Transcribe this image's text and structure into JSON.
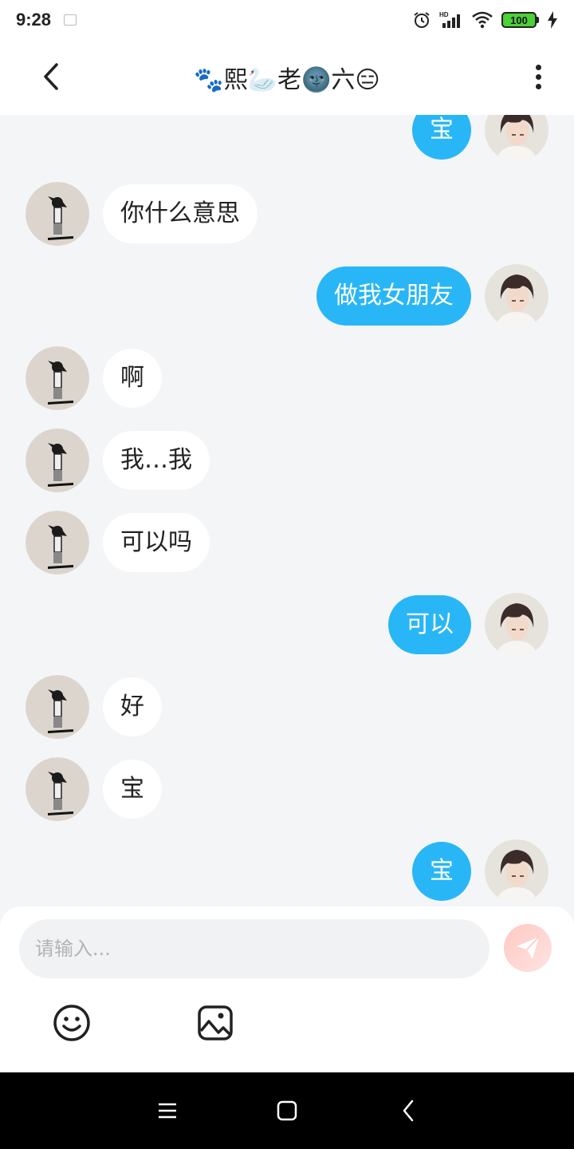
{
  "status_bar": {
    "time": "9:28",
    "network_label": "HD",
    "battery_level": "100",
    "battery_color": "#4cd136"
  },
  "header": {
    "title": "🐾熙🦢老🌚六😑",
    "back_icon": "chevron-left-icon",
    "more_icon": "more-vertical-icon"
  },
  "messages": [
    {
      "side": "right",
      "text": "宝"
    },
    {
      "side": "left",
      "text": "你什么意思"
    },
    {
      "side": "right",
      "text": "做我女朋友"
    },
    {
      "side": "left",
      "text": "啊"
    },
    {
      "side": "left",
      "text": "我…我"
    },
    {
      "side": "left",
      "text": "可以吗"
    },
    {
      "side": "right",
      "text": "可以"
    },
    {
      "side": "left",
      "text": "好"
    },
    {
      "side": "left",
      "text": "宝"
    },
    {
      "side": "right",
      "text": "宝"
    }
  ],
  "input": {
    "placeholder": "请输入...",
    "value": ""
  },
  "toolbar": {
    "send_icon": "send-icon",
    "emoji_icon": "emoji-icon",
    "image_icon": "image-icon"
  },
  "nav": {
    "menu_icon": "menu-icon",
    "home_icon": "home-icon",
    "back_icon": "back-icon"
  },
  "colors": {
    "sent_bubble": "#29b6f6",
    "received_bubble": "#ffffff",
    "chat_background": "#f4f5f7"
  }
}
